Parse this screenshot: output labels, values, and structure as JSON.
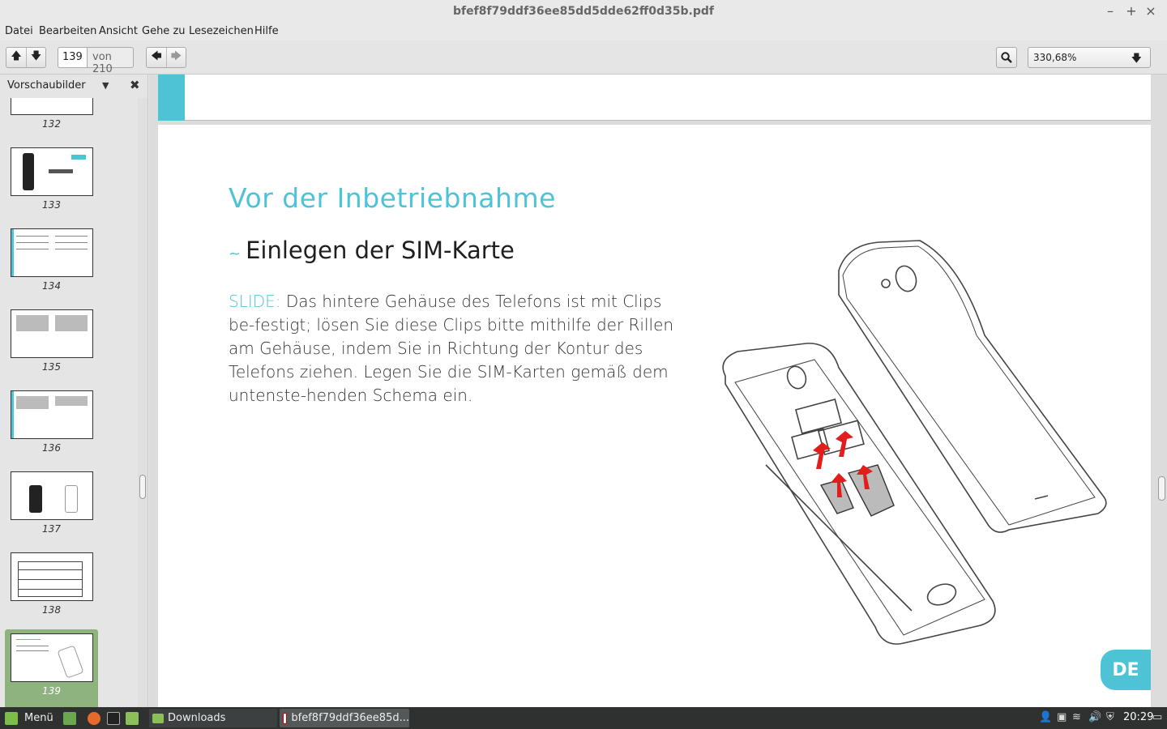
{
  "window": {
    "title": "bfef8f79ddf36ee85dd5dde62ff0d35b.pdf",
    "minimize": "–",
    "maximize": "+",
    "close": "×"
  },
  "menu": [
    "Datei",
    "Bearbeiten",
    "Ansicht",
    "Gehe zu",
    "Lesezeichen",
    "Hilfe"
  ],
  "toolbar": {
    "prev_page": "🡅",
    "next_page": "🡇",
    "current_page": "139",
    "page_total": "von 210",
    "back": "🡄",
    "forward": "🡆",
    "zoom": "330,68%",
    "zoom_arrow": "🡇"
  },
  "sidebar": {
    "title": "Vorschaubilder",
    "dropdown": "▼",
    "close": "✖",
    "thumbnails": [
      {
        "num": "132"
      },
      {
        "num": "133"
      },
      {
        "num": "134"
      },
      {
        "num": "135"
      },
      {
        "num": "136"
      },
      {
        "num": "137"
      },
      {
        "num": "138"
      },
      {
        "num": "139",
        "selected": true
      }
    ]
  },
  "document": {
    "heading": "Vor der Inbetriebnahme",
    "tilde": "~",
    "subheading": "Einlegen der SIM-Karte",
    "keyword": "SLIDE:",
    "body": " Das hintere Gehäuse des Telefons ist mit Clips be-festigt; lösen Sie diese Clips bitte mithilfe der Rillen am Gehäuse, indem Sie in Richtung der Kontur des Telefons ziehen. Legen Sie die SIM-Karten gemäß dem untenste-henden Schema ein.",
    "badge": "DE"
  },
  "taskbar": {
    "menu": "Menü",
    "tasks": [
      {
        "label": "Downloads"
      },
      {
        "label": "bfef8f79ddf36ee85d..."
      }
    ],
    "clock": "20:29"
  },
  "colors": {
    "accent": "#4fc3d6",
    "selection": "#8fb37e",
    "taskbar": "#2f3131"
  }
}
